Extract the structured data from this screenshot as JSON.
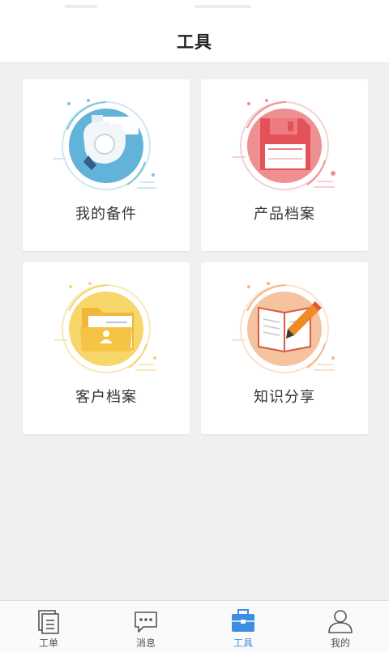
{
  "header": {
    "title": "工具"
  },
  "tools": [
    {
      "label": "我的备件",
      "icon": "camera-spare-part-icon",
      "color": "#62b3d9"
    },
    {
      "label": "产品档案",
      "icon": "product-file-icon",
      "color": "#e96b70"
    },
    {
      "label": "客户档案",
      "icon": "customer-folder-icon",
      "color": "#f7d66a"
    },
    {
      "label": "知识分享",
      "icon": "book-pencil-icon",
      "color": "#f5b88a"
    }
  ],
  "tabbar": {
    "items": [
      {
        "label": "工单",
        "icon": "work-order-icon"
      },
      {
        "label": "消息",
        "icon": "message-icon"
      },
      {
        "label": "工具",
        "icon": "toolbox-icon",
        "active": true
      },
      {
        "label": "我的",
        "icon": "profile-icon"
      }
    ],
    "active_color": "#3d8de0"
  }
}
